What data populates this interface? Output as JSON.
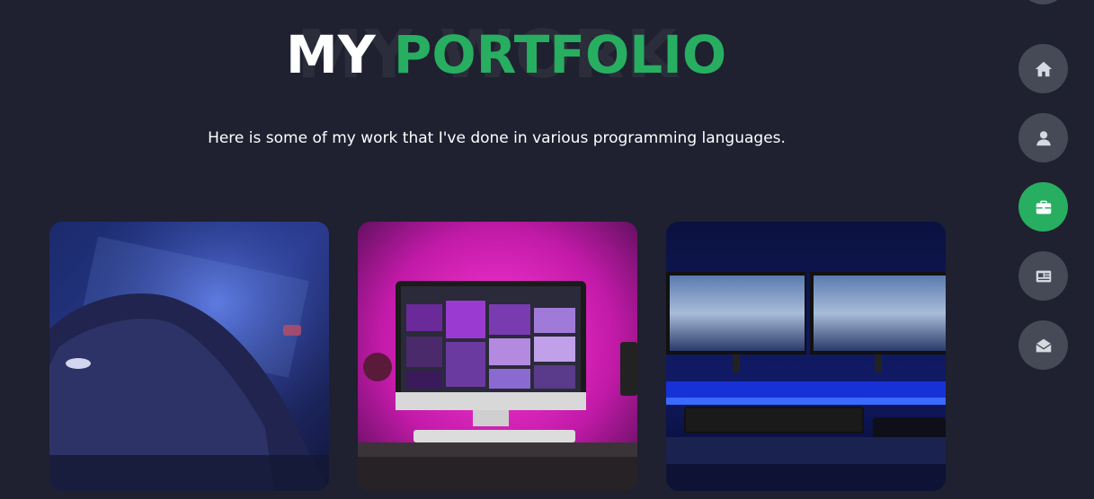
{
  "header": {
    "background_word": "MY WORK",
    "title_white": "MY",
    "title_green": "PORTFOLIO",
    "subtitle": "Here is some of my work that I've done in various programming languages."
  },
  "colors": {
    "background": "#1f2030",
    "accent": "#27ae60",
    "nav_button": "#454a56",
    "text": "#ffffff"
  },
  "portfolio": {
    "items": [
      {
        "name": "keyboard-hand-photo"
      },
      {
        "name": "pink-desk-imac-photo"
      },
      {
        "name": "blue-dual-monitor-photo"
      }
    ]
  },
  "nav": {
    "items": [
      {
        "icon": "home-icon",
        "active": false
      },
      {
        "icon": "user-icon",
        "active": false
      },
      {
        "icon": "briefcase-icon",
        "active": true
      },
      {
        "icon": "newspaper-icon",
        "active": false
      },
      {
        "icon": "envelope-open-icon",
        "active": false
      }
    ]
  }
}
